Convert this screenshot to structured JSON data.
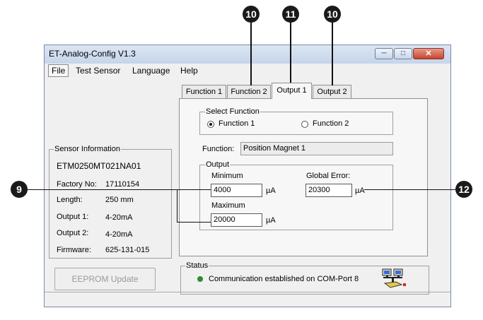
{
  "callouts": {
    "c10a": "10",
    "c11": "11",
    "c10b": "10",
    "c9": "9",
    "c12": "12"
  },
  "window": {
    "title": "ET-Analog-Config V1.3"
  },
  "menu": [
    "File",
    "Test Sensor",
    "Language",
    "Help"
  ],
  "sensor_info": {
    "title": "Sensor Information",
    "model": "ETM0250MT021NA01",
    "rows": [
      {
        "label": "Factory No:",
        "value": "17110154"
      },
      {
        "label": "Length:",
        "value": "250 mm"
      },
      {
        "label": "Output 1:",
        "value": "4-20mA"
      },
      {
        "label": "Output 2:",
        "value": "4-20mA"
      },
      {
        "label": "Firmware:",
        "value": "625-131-015"
      }
    ]
  },
  "eeprom_button": "EEPROM Update",
  "tabs": [
    "Function 1",
    "Function 2",
    "Output 1",
    "Output 2"
  ],
  "select_function": {
    "title": "Select Function",
    "option1": "Function 1",
    "option2": "Function 2"
  },
  "function": {
    "label": "Function:",
    "value": "Position Magnet 1"
  },
  "output": {
    "title": "Output",
    "min_label": "Minimum",
    "min_value": "4000",
    "min_unit": "µA",
    "max_label": "Maximum",
    "max_value": "20000",
    "max_unit": "µA",
    "global_error_label": "Global Error:",
    "global_error_value": "20300",
    "global_error_unit": "µA"
  },
  "status": {
    "title": "Status",
    "message": "Communication established on COM-Port 8"
  },
  "colors": {
    "status_led": "#2e8b2e",
    "callout": "#1a1a1a"
  },
  "icons": {
    "network": "network-computers-icon"
  }
}
